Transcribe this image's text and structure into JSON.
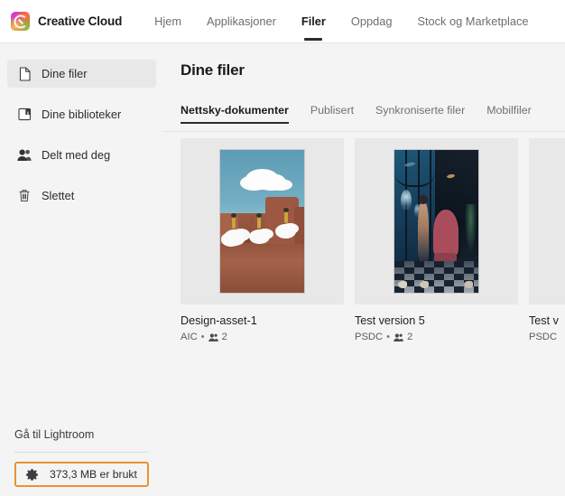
{
  "header": {
    "brand": "Creative Cloud",
    "logo_icon": "creative-cloud-logo",
    "nav": [
      {
        "label": "Hjem",
        "active": false
      },
      {
        "label": "Applikasjoner",
        "active": false
      },
      {
        "label": "Filer",
        "active": true
      },
      {
        "label": "Oppdag",
        "active": false
      },
      {
        "label": "Stock og Marketplace",
        "active": false
      }
    ]
  },
  "sidebar": {
    "items": [
      {
        "label": "Dine filer",
        "icon": "document-icon",
        "selected": true
      },
      {
        "label": "Dine biblioteker",
        "icon": "library-icon",
        "selected": false
      },
      {
        "label": "Delt med deg",
        "icon": "people-icon",
        "selected": false
      },
      {
        "label": "Slettet",
        "icon": "trash-icon",
        "selected": false
      }
    ],
    "lightroom_link": "Gå til Lightroom",
    "storage": {
      "icon": "gear-icon",
      "label": "373,3 MB er brukt",
      "highlight_color": "#e8932f"
    }
  },
  "main": {
    "title": "Dine filer",
    "tabs": [
      {
        "label": "Nettsky-dokumenter",
        "active": true
      },
      {
        "label": "Publisert",
        "active": false
      },
      {
        "label": "Synkroniserte filer",
        "active": false
      },
      {
        "label": "Mobilfiler",
        "active": false
      }
    ],
    "files": [
      {
        "title": "Design-asset-1",
        "format": "AIC",
        "separator": "•",
        "collaborators": "2",
        "thumbnail": "desert-canyon-clouds-artwork"
      },
      {
        "title": "Test version 5",
        "format": "PSDC",
        "separator": "•",
        "collaborators": "2",
        "thumbnail": "underwater-room-jellyfish-artwork"
      },
      {
        "title": "Test v",
        "format": "PSDC",
        "separator": "",
        "collaborators": "",
        "thumbnail": "partial-card-cut-off"
      }
    ]
  }
}
